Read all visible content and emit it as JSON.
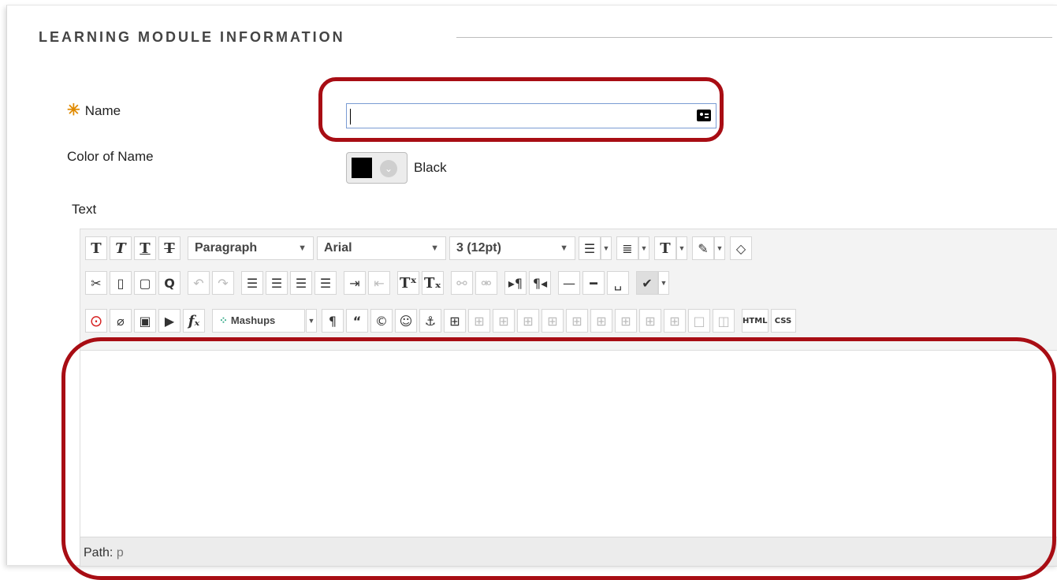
{
  "section": {
    "title": "LEARNING MODULE INFORMATION"
  },
  "form": {
    "name_label": "Name",
    "name_value": "",
    "color_label": "Color of Name",
    "color_value": "Black",
    "color_hex": "#000000",
    "text_label": "Text"
  },
  "toolbar": {
    "row1": {
      "bold": "T",
      "italic": "T",
      "underline": "T",
      "strike": "T",
      "format_block": "Paragraph",
      "font_family": "Arial",
      "font_size": "3 (12pt)"
    },
    "row3": {
      "mashups": "Mashups",
      "html": "HTML",
      "css": "CSS"
    }
  },
  "path_bar": {
    "label": "Path:",
    "value": "p"
  },
  "colors": {
    "highlight": "#a80d14",
    "required": "#e08a00",
    "input_border": "#7a9bd3"
  }
}
